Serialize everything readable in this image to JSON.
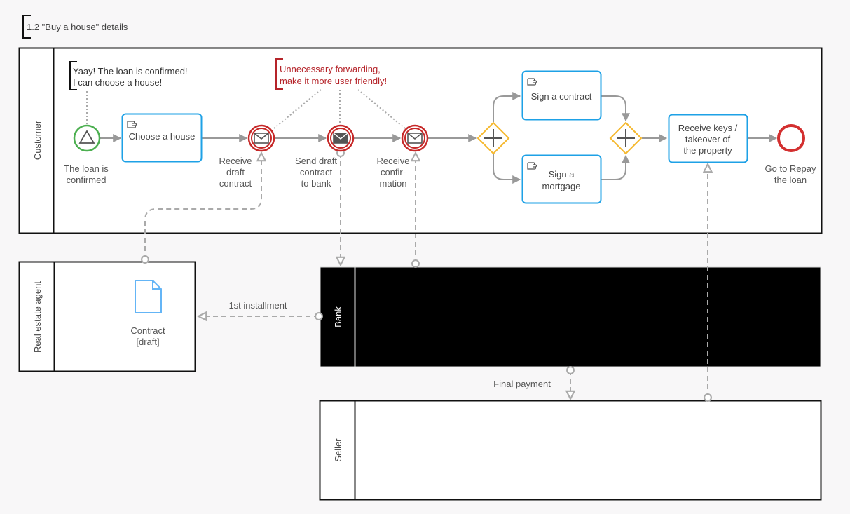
{
  "title": "1.2 \"Buy a house\" details",
  "colors": {
    "task_border": "#1ea1e6",
    "start_event": "#4caf50",
    "end_event": "#d32f2f",
    "intermediate_event": "#c62828",
    "gateway": "#f5b82e",
    "annotation_red": "#b5242a",
    "data_object": "#64b5f6",
    "flow": "#999999",
    "bank_pool_fill": "#000000"
  },
  "pools": {
    "customer": {
      "label": "Customer"
    },
    "real_estate_agent": {
      "label": "Real estate agent"
    },
    "bank": {
      "label": "Bank"
    },
    "seller": {
      "label": "Seller"
    }
  },
  "annotations": {
    "loan_confirmed_note": {
      "line1": "Yaay! The loan is confirmed!",
      "line2": "I can choose a house!"
    },
    "forwarding_note": {
      "line1": "Unnecessary forwarding,",
      "line2": "make it more user friendly!"
    }
  },
  "events": {
    "start": {
      "type": "signal-start",
      "line1": "The loan is",
      "line2": "confirmed"
    },
    "receive_draft": {
      "type": "message-catch",
      "line1": "Receive",
      "line2": "draft",
      "line3": "contract"
    },
    "send_draft": {
      "type": "message-throw",
      "line1": "Send draft",
      "line2": "contract",
      "line3": "to bank"
    },
    "receive_confirmation": {
      "type": "message-catch",
      "line1": "Receive",
      "line2": "confir-",
      "line3": "mation"
    },
    "end": {
      "type": "end",
      "line1": "Go to Repay",
      "line2": "the loan"
    }
  },
  "tasks": {
    "choose_house": {
      "type": "manual",
      "line1": "Choose a house"
    },
    "sign_contract": {
      "type": "manual",
      "line1": "Sign a contract"
    },
    "sign_mortgage": {
      "type": "manual",
      "line1": "Sign a",
      "line2": "mortgage"
    },
    "receive_keys": {
      "type": "task",
      "line1": "Receive keys /",
      "line2": "takeover of",
      "line3": "the property"
    }
  },
  "gateways": {
    "split": {
      "type": "parallel"
    },
    "join": {
      "type": "parallel"
    }
  },
  "data_objects": {
    "contract": {
      "line1": "Contract",
      "line2": "[draft]"
    }
  },
  "message_flows": {
    "first_installment": {
      "label": "1st installment"
    },
    "final_payment": {
      "label": "Final payment"
    }
  }
}
